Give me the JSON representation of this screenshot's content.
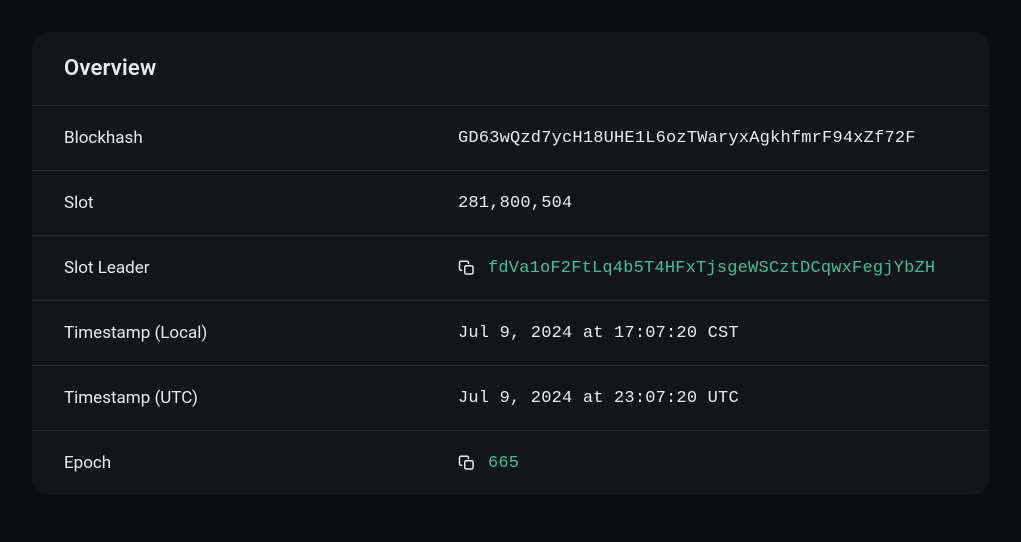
{
  "overview": {
    "title": "Overview",
    "rows": {
      "blockhash": {
        "label": "Blockhash",
        "value": "GD63wQzd7ycH18UHE1L6ozTWaryxAgkhfmrF94xZf72F"
      },
      "slot": {
        "label": "Slot",
        "value": "281,800,504"
      },
      "slot_leader": {
        "label": "Slot Leader",
        "value": "fdVa1oF2FtLq4b5T4HFxTjsgeWSCztDCqwxFegjYbZH"
      },
      "timestamp_local": {
        "label": "Timestamp (Local)",
        "value": "Jul 9, 2024 at 17:07:20 CST"
      },
      "timestamp_utc": {
        "label": "Timestamp (UTC)",
        "value": "Jul 9, 2024 at 23:07:20 UTC"
      },
      "epoch": {
        "label": "Epoch",
        "value": "665"
      }
    }
  },
  "colors": {
    "accent": "#3fbf9e",
    "text": "#e8eaed",
    "bg": "#0b0d0e",
    "card": "#131617",
    "border": "#23282a"
  }
}
